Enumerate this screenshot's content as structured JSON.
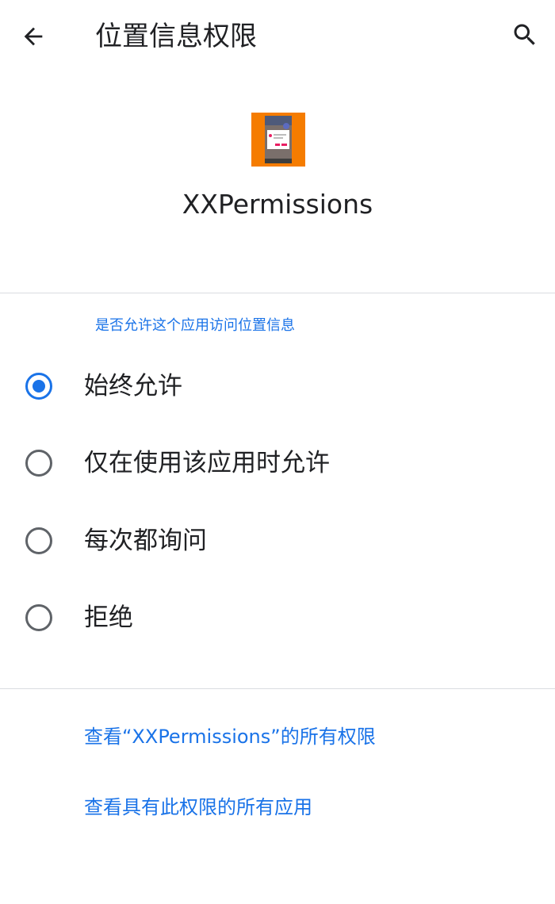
{
  "toolbar": {
    "title": "位置信息权限",
    "back_icon": "arrow-back-icon",
    "search_icon": "search-icon"
  },
  "app": {
    "name": "XXPermissions",
    "icon": "app-icon",
    "icon_colors": {
      "background": "#f57c00",
      "phone": "#7a6f6b",
      "accent": "#e91e63"
    }
  },
  "permission": {
    "prompt": "是否允许这个应用访问位置信息",
    "options": [
      {
        "label": "始终允许",
        "selected": true
      },
      {
        "label": "仅在使用该应用时允许",
        "selected": false
      },
      {
        "label": "每次都询问",
        "selected": false
      },
      {
        "label": "拒绝",
        "selected": false
      }
    ]
  },
  "links": {
    "all_permissions": "查看“XXPermissions”的所有权限",
    "all_apps": "查看具有此权限的所有应用"
  },
  "colors": {
    "accent": "#1a73e8",
    "text": "#202124",
    "radio_unchecked": "#5f6368",
    "divider": "#dadce0"
  }
}
